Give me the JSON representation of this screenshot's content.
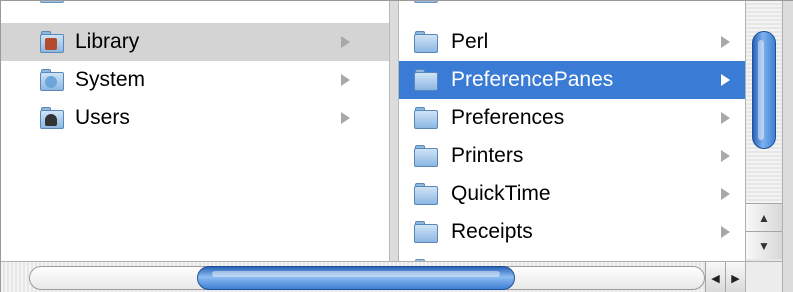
{
  "column1": {
    "items": [
      {
        "label": "Library",
        "icon": "library-folder-icon",
        "state": "path"
      },
      {
        "label": "System",
        "icon": "system-folder-icon",
        "state": "normal"
      },
      {
        "label": "Users",
        "icon": "users-folder-icon",
        "state": "normal"
      }
    ]
  },
  "column2": {
    "items": [
      {
        "label": "Perl",
        "icon": "folder-icon",
        "state": "normal"
      },
      {
        "label": "PreferencePanes",
        "icon": "folder-icon",
        "state": "selected"
      },
      {
        "label": "Preferences",
        "icon": "folder-icon",
        "state": "normal"
      },
      {
        "label": "Printers",
        "icon": "folder-icon",
        "state": "normal"
      },
      {
        "label": "QuickTime",
        "icon": "folder-icon",
        "state": "normal"
      },
      {
        "label": "Receipts",
        "icon": "folder-icon",
        "state": "normal"
      }
    ]
  },
  "colors": {
    "selection": "#3a7bd5",
    "path_highlight": "#d4d4d4",
    "scroll_thumb": "#3f7fd3"
  },
  "scroll": {
    "vertical_up": "▲",
    "vertical_down": "▼",
    "horizontal_left": "◀",
    "horizontal_right": "▶"
  }
}
